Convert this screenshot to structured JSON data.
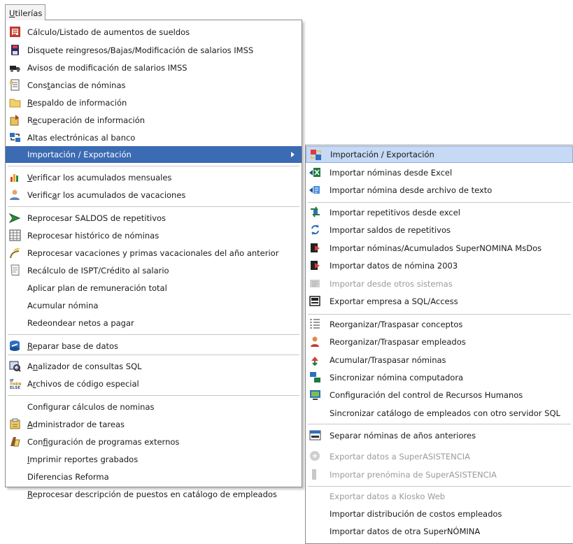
{
  "menubar": {
    "title": "Utilerías"
  },
  "main_menu": {
    "items": [
      {
        "label": "Cálculo/Listado de aumentos de sueldos",
        "icon": "calc-sheet-icon"
      },
      {
        "label": "Disquete reingresos/Bajas/Modificación de salarios IMSS",
        "icon": "disk-icon"
      },
      {
        "label": "Avisos de modificación de salarios IMSS",
        "icon": "truck-icon"
      },
      {
        "label": "Constancias de nóminas",
        "icon": "document-icon"
      },
      {
        "label": "Respaldo de información",
        "icon": "folder-icon"
      },
      {
        "label": "Recuperación de información",
        "icon": "restore-icon"
      },
      {
        "label": "Altas electrónicas al banco",
        "icon": "bank-transfer-icon"
      },
      {
        "label": "Importación / Exportación",
        "icon": "",
        "has_submenu": true
      },
      {
        "label": "Verificar los acumulados mensuales",
        "icon": "bar-check-icon"
      },
      {
        "label": "Verificar los acumulados de vacaciones",
        "icon": "people-icon"
      },
      {
        "label": "Reprocesar SALDOS de repetitivos",
        "icon": "arrow-green-icon"
      },
      {
        "label": "Reprocesar histórico de nóminas",
        "icon": "grid-icon"
      },
      {
        "label": "Reprocesar vacaciones y primas vacacionales del año anterior",
        "icon": "beach-icon"
      },
      {
        "label": "Recálculo de ISPT/Crédito al salario",
        "icon": "receipt-icon"
      },
      {
        "label": "Aplicar plan de remuneración total",
        "icon": ""
      },
      {
        "label": "Acumular nómina",
        "icon": ""
      },
      {
        "label": "Redeondear netos a pagar",
        "icon": ""
      },
      {
        "label": "Reparar base de datos",
        "icon": "repair-db-icon"
      },
      {
        "label": "Analizador de consultas SQL",
        "icon": "sql-icon"
      },
      {
        "label": "Archivos de código especial",
        "icon": "if-then-else-icon"
      },
      {
        "label": "Configurar cálculos de nominas",
        "icon": ""
      },
      {
        "label": "Administrador de tareas",
        "icon": "tasks-icon"
      },
      {
        "label": "Configuración de programas externos",
        "icon": "external-program-icon"
      },
      {
        "label": "Imprimir reportes grabados",
        "icon": ""
      },
      {
        "label": "Diferencias Reforma",
        "icon": ""
      },
      {
        "label": "Reprocesar descripción de puestos en catálogo de empleados",
        "icon": ""
      }
    ]
  },
  "sub_menu": {
    "items": [
      {
        "label": "Importación / Exportación",
        "icon": "import-export-icon"
      },
      {
        "label": "Importar nóminas desde Excel",
        "icon": "excel-import-icon"
      },
      {
        "label": "Importar nómina desde archivo de texto",
        "icon": "text-import-icon"
      },
      {
        "label": "Importar repetitivos desde excel",
        "icon": "repeat-excel-icon"
      },
      {
        "label": "Importar saldos de repetitivos",
        "icon": "refresh-icon"
      },
      {
        "label": "Importar nóminas/Acumulados SuperNOMINA MsDos",
        "icon": "import-red-icon"
      },
      {
        "label": "Importar datos de nómina 2003",
        "icon": "import-red-2003-icon"
      },
      {
        "label": "Importar desde otros sistemas",
        "icon": "other-systems-icon"
      },
      {
        "label": "Exportar empresa a SQL/Access",
        "icon": "export-sql-icon"
      },
      {
        "label": "Reorganizar/Traspasar conceptos",
        "icon": "list-icon"
      },
      {
        "label": "Reorganizar/Traspasar empleados",
        "icon": "employee-icon"
      },
      {
        "label": "Acumular/Traspasar nóminas",
        "icon": "accumulate-icon"
      },
      {
        "label": "Sincronizar nómina computadora",
        "icon": "sync-computer-icon"
      },
      {
        "label": "Configuración del control de Recursos Humanos",
        "icon": "hr-config-icon"
      },
      {
        "label": "Sincronizar catálogo de empleados con otro servidor SQL",
        "icon": ""
      },
      {
        "label": "Separar nóminas de años anteriores",
        "icon": "calendar-split-icon"
      },
      {
        "label": "Exportar datos  a SuperASISTENCIA",
        "icon": "export-asistencia-icon"
      },
      {
        "label": "Importar prenómina de SuperASISTENCIA",
        "icon": "import-asistencia-icon"
      },
      {
        "label": "Exportar datos a Kiosko Web",
        "icon": ""
      },
      {
        "label": "Importar distribución de costos empleados",
        "icon": ""
      },
      {
        "label": "Importar datos de otra SuperNÓMINA",
        "icon": ""
      }
    ]
  },
  "colors": {
    "selection": "#3b6bb3",
    "sub_hover": "#c6d9f5",
    "disabled_text": "#9a9a9a"
  }
}
